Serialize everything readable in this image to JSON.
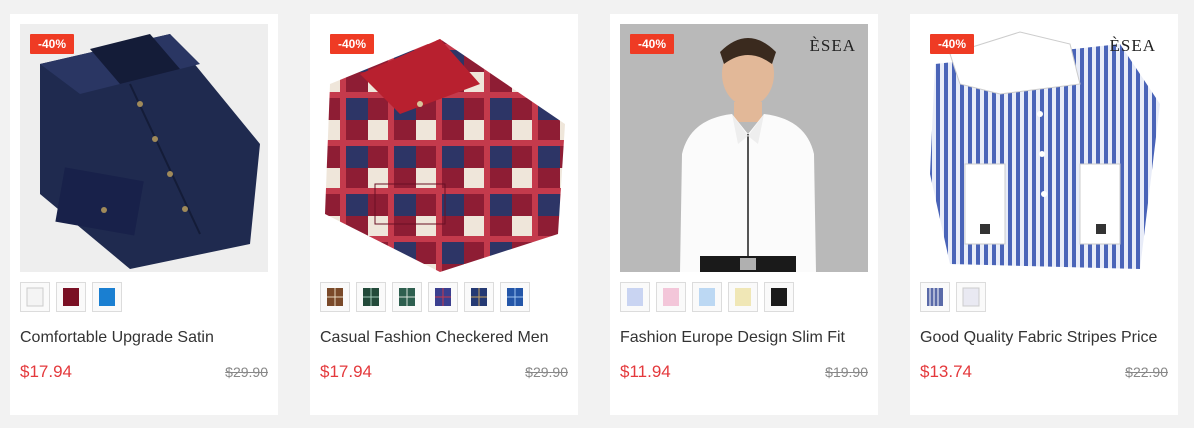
{
  "products": [
    {
      "discount": "-40%",
      "brand": "",
      "title": "Comfortable Upgrade Satin",
      "price": "$17.94",
      "old_price": "$29.90",
      "image_bg": "#eeeeee",
      "shirt_color": "#1f2a4f",
      "thumb_colors": [
        "#f4f4f4",
        "#7a1024",
        "#1a7fd1"
      ]
    },
    {
      "discount": "-40%",
      "brand": "",
      "title": "Casual Fashion Checkered Men",
      "price": "$17.94",
      "old_price": "$29.90",
      "image_bg": "#ffffff",
      "shirt_color": "#8e1d34",
      "thumb_colors": [
        "#7a4a2a",
        "#234a3a",
        "#2e5f4f",
        "#3b3f8f",
        "#253a74",
        "#2456a8"
      ]
    },
    {
      "discount": "-40%",
      "brand": "ÈSEA",
      "title": "Fashion Europe Design Slim Fit",
      "price": "$11.94",
      "old_price": "$19.90",
      "image_bg": "#b9b9b9",
      "shirt_color": "#fbfbfb",
      "thumb_colors": [
        "#c9d4f2",
        "#f3c6d9",
        "#bcd8f3",
        "#f0e7b6",
        "#1b1b1b"
      ]
    },
    {
      "discount": "-40%",
      "brand": "ÈSEA",
      "title": "Good Quality Fabric Stripes Price",
      "price": "$13.74",
      "old_price": "$22.90",
      "image_bg": "#ffffff",
      "shirt_color": "#4a64b8",
      "thumb_colors": [
        "#5a6aa8",
        "#e9e9f2"
      ]
    }
  ]
}
